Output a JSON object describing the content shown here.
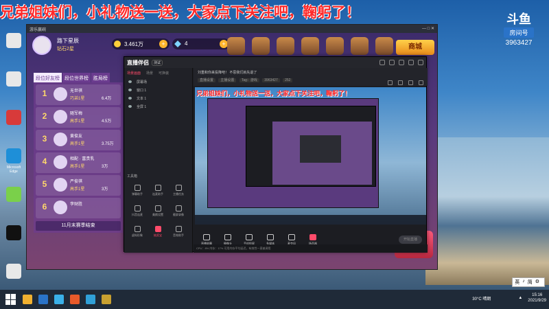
{
  "overlay_text": "兄弟姐妹们，小礼物送一送，大家点下关注吧，鞠躬了！",
  "douyu": {
    "mark": "斗鱼",
    "sub": "房间号",
    "room": "3963427"
  },
  "desktop_icons": [
    {
      "label": "",
      "color": "#e8e8e8"
    },
    {
      "label": "",
      "color": "#e8e8e8"
    },
    {
      "label": "",
      "color": "#d83a3a"
    },
    {
      "label": "Microsoft Edge",
      "color": "#1e8fd8"
    },
    {
      "label": "",
      "color": "#7ad04a"
    },
    {
      "label": "",
      "color": "#111111"
    },
    {
      "label": "",
      "color": "#e8e8e8"
    }
  ],
  "game": {
    "title": "游乐赢碗",
    "player_name": "路下星辰",
    "player_tier": "钻石2星",
    "coins": "3.461万",
    "gems": "4",
    "shop_label": "商城",
    "rank_tabs": [
      "段位好友榜",
      "段位世界榜",
      "胜局榜"
    ],
    "rank_rows": [
      {
        "num": "1",
        "name": "无世祺",
        "tier": "巧弟1星",
        "val": "6.4万"
      },
      {
        "num": "2",
        "name": "随军梅",
        "tier": "高手1星",
        "val": "4.5万"
      },
      {
        "num": "3",
        "name": "黄俊友",
        "tier": "高手1星",
        "val": "3.75万"
      },
      {
        "num": "4",
        "name": "相配 · 富贵乳",
        "tier": "高手1星",
        "val": "3万"
      },
      {
        "num": "5",
        "name": "严俊祺",
        "tier": "高手1星",
        "val": "3万"
      },
      {
        "num": "6",
        "name": "李财胜",
        "tier": "",
        "val": ""
      }
    ],
    "season_end": "11月末赛季结束"
  },
  "companion": {
    "logo": "直播伴侣",
    "badge": "测试",
    "left_tabs": [
      "场景画面",
      "场景",
      "可换装"
    ],
    "sources": [
      "屏幕场",
      "窗口 1",
      "文本 1",
      "全屏 1"
    ],
    "tool_header": "工具箱",
    "tools": [
      {
        "label": "弹幕助手",
        "hot": false
      },
      {
        "label": "连麦助手",
        "hot": false
      },
      {
        "label": "主播任务",
        "hot": false
      },
      {
        "label": "抖音连麦",
        "hot": false
      },
      {
        "label": "美颜设置",
        "hot": false
      },
      {
        "label": "截屏录像",
        "hot": false
      },
      {
        "label": "虚拟形象",
        "hot": false
      },
      {
        "label": "抽奖宝",
        "hot": true
      },
      {
        "label": "音效助手",
        "hot": false
      }
    ],
    "info_line": "刘重和你来投降吧！ 不思我们就先退了",
    "info_tags": [
      "直播设置",
      "主播设置",
      "Tag：游戏",
      "3963427",
      "252"
    ],
    "preview_text": "兄弟姐妹们，小礼物送一送，大家点下关注吧，鞠躬了！",
    "controls": [
      {
        "label": "直播屏幕",
        "vol": false
      },
      {
        "label": "摄像头",
        "vol": false
      },
      {
        "label": "手机投屏",
        "vol": false
      },
      {
        "label": "多媒体",
        "vol": false
      },
      {
        "label": "麦克风",
        "vol": false
      },
      {
        "label": "扬声器",
        "vol": true
      }
    ],
    "start_label": "开始直播",
    "status_text": "CPU：8%   内存：17%   可用内存平均延迟，有效性一直被调用"
  },
  "taskbar": {
    "apps": [
      "#f0b030",
      "#2a73c8",
      "#3ab0e8",
      "#e85a2a",
      "#30a0d8",
      "#c8a030"
    ],
    "weather": "30°C 晴朗",
    "time": "15:16",
    "date": "2021/9/29"
  },
  "ime": {
    "items": [
      "英",
      "♪",
      "简",
      "⚙"
    ]
  }
}
